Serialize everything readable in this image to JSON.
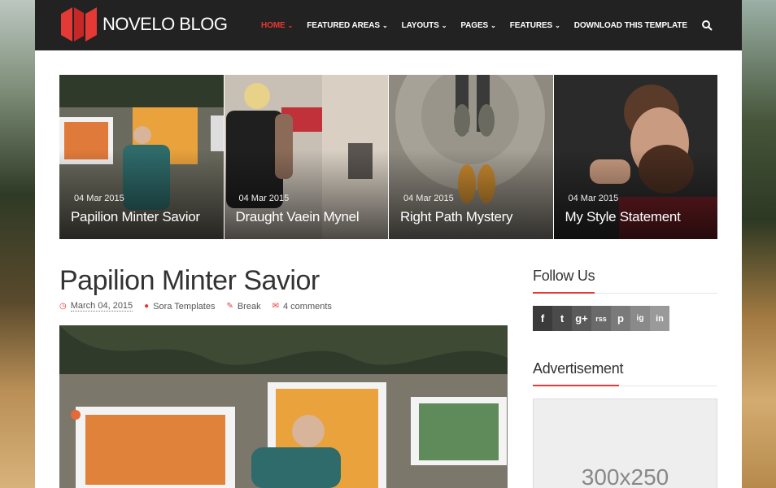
{
  "brand": {
    "name": "NOVELO BLOG"
  },
  "nav": {
    "items": [
      {
        "label": "HOME",
        "active": true
      },
      {
        "label": "FEATURED AREAS"
      },
      {
        "label": "LAYOUTS"
      },
      {
        "label": "PAGES"
      },
      {
        "label": "FEATURES"
      },
      {
        "label": "DOWNLOAD THIS TEMPLATE"
      }
    ],
    "search_icon": "search-icon"
  },
  "featured": [
    {
      "date": "04 Mar 2015",
      "title": "Papilion Minter Savior"
    },
    {
      "date": "04 Mar 2015",
      "title": "Draught Vaein Mynel"
    },
    {
      "date": "04 Mar 2015",
      "title": "Right Path Mystery"
    },
    {
      "date": "04 Mar 2015",
      "title": "My Style Statement"
    }
  ],
  "post": {
    "title": "Papilion Minter Savior",
    "date": "March 04, 2015",
    "author": "Sora Templates",
    "category": "Break",
    "comments": "4 comments"
  },
  "sidebar": {
    "follow_title": "Follow Us",
    "social": [
      "f",
      "t",
      "g+",
      "rss",
      "p",
      "ig",
      "in"
    ],
    "ad_title": "Advertisement",
    "ad_placeholder": "300x250"
  },
  "colors": {
    "accent": "#e53935",
    "header_bg": "#222222"
  }
}
